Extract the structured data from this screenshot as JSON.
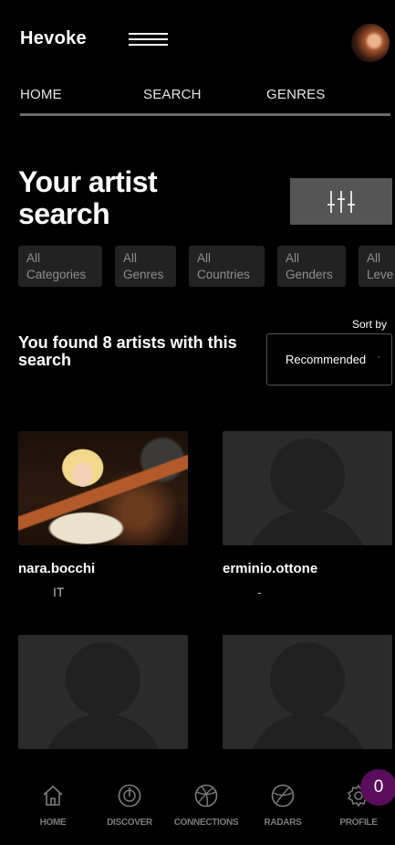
{
  "header": {
    "logo": "Hevoke"
  },
  "nav": {
    "tabs": [
      {
        "label": "HOME"
      },
      {
        "label": "SEARCH"
      },
      {
        "label": "GENRES"
      }
    ]
  },
  "page": {
    "title": "Your artist search"
  },
  "filters": [
    {
      "line1": "All",
      "line2": "Categories"
    },
    {
      "line1": "All",
      "line2": "Genres"
    },
    {
      "line1": "All",
      "line2": "Countries"
    },
    {
      "line1": "All",
      "line2": "Genders"
    },
    {
      "line1": "All",
      "line2": "Leve"
    }
  ],
  "results": {
    "summary": "You found 8 artists with this search"
  },
  "sort": {
    "label": "Sort by",
    "selected": "Recommended"
  },
  "artists": [
    {
      "name": "nara.bocchi",
      "country": "IT"
    },
    {
      "name": "erminio.ottone",
      "country": "-"
    },
    {
      "name": "",
      "country": ""
    },
    {
      "name": "",
      "country": ""
    }
  ],
  "bottom_nav": [
    {
      "label": "HOME",
      "icon": "home-icon"
    },
    {
      "label": "DISCOVER",
      "icon": "discover-icon"
    },
    {
      "label": "CONNECTIONS",
      "icon": "connections-icon"
    },
    {
      "label": "RADARS",
      "icon": "radar-icon"
    },
    {
      "label": "PROFILE",
      "icon": "gear-icon"
    }
  ],
  "notifications": {
    "count": "0"
  },
  "colors": {
    "background": "#000000",
    "chip": "#222222",
    "badge": "#5a0d5c",
    "placeholder": "#2b2b2b"
  }
}
